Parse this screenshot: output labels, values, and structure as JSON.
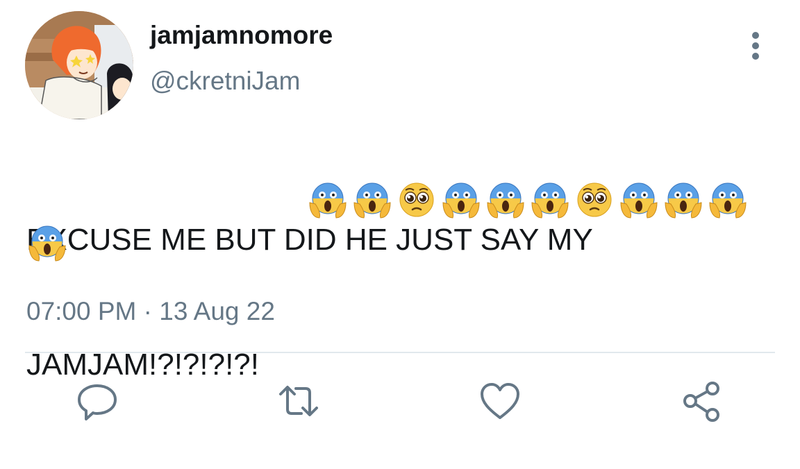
{
  "tweet": {
    "author": {
      "display_name": "jamjamnomore",
      "handle": "@ckretniJam",
      "avatar_icon": "anime-character-avatar"
    },
    "text_line1": "EXCUSE ME BUT DID HE JUST SAY MY",
    "text_line2_prefix": "JAMJAM!?!?!?!?!",
    "emojis": [
      "scream",
      "scream",
      "pleading",
      "scream",
      "scream",
      "scream",
      "pleading",
      "scream",
      "scream",
      "scream",
      "scream"
    ],
    "timestamp": "07:00 PM · 13 Aug 22"
  },
  "actions": {
    "reply_icon": "reply-icon",
    "retweet_icon": "retweet-icon",
    "like_icon": "heart-icon",
    "share_icon": "share-icon"
  },
  "colors": {
    "text": "#14171a",
    "secondary": "#657786",
    "divider": "#e1e8ed"
  }
}
